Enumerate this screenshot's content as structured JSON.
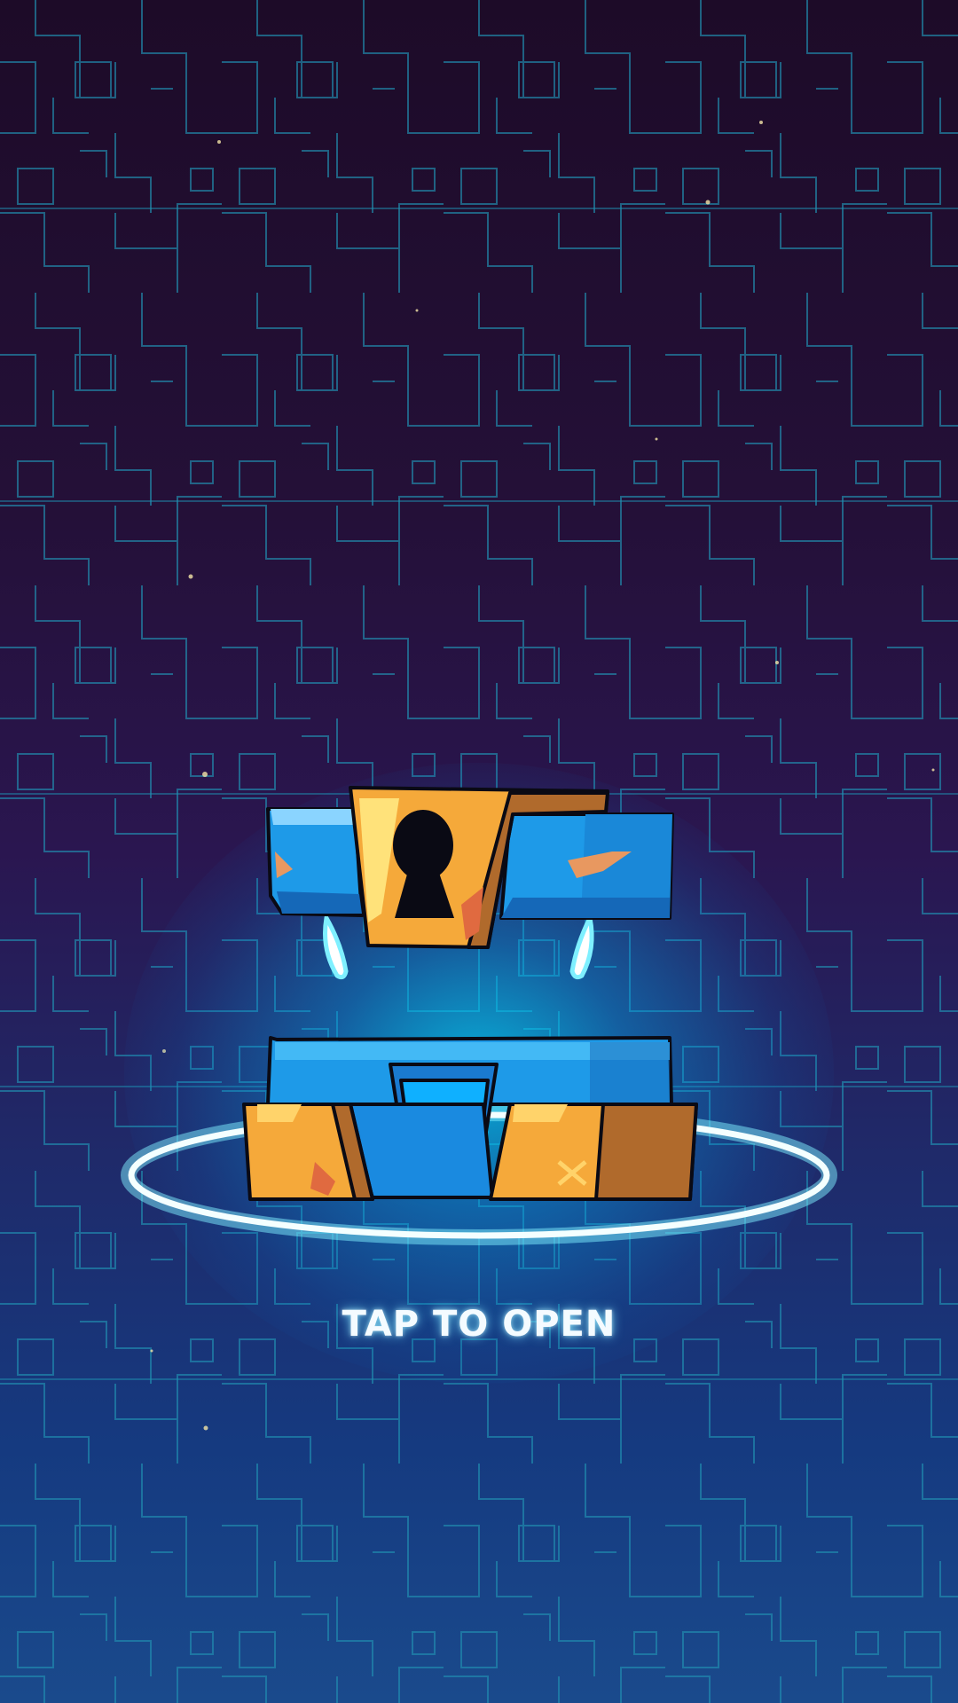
{
  "screen": {
    "action_label": "TAP TO OPEN"
  },
  "chest": {
    "icon": "treasure-chest-icon",
    "lock_icon": "keyhole-icon"
  },
  "colors": {
    "background_top": "#1d0b28",
    "background_bottom": "#1a4a8c",
    "grid_line": "#1f8fb0",
    "glow": "#00dcff",
    "chest_blue": "#1e9ae8",
    "chest_gold": "#f5a93a",
    "chest_dark_gold": "#b06a2c"
  }
}
